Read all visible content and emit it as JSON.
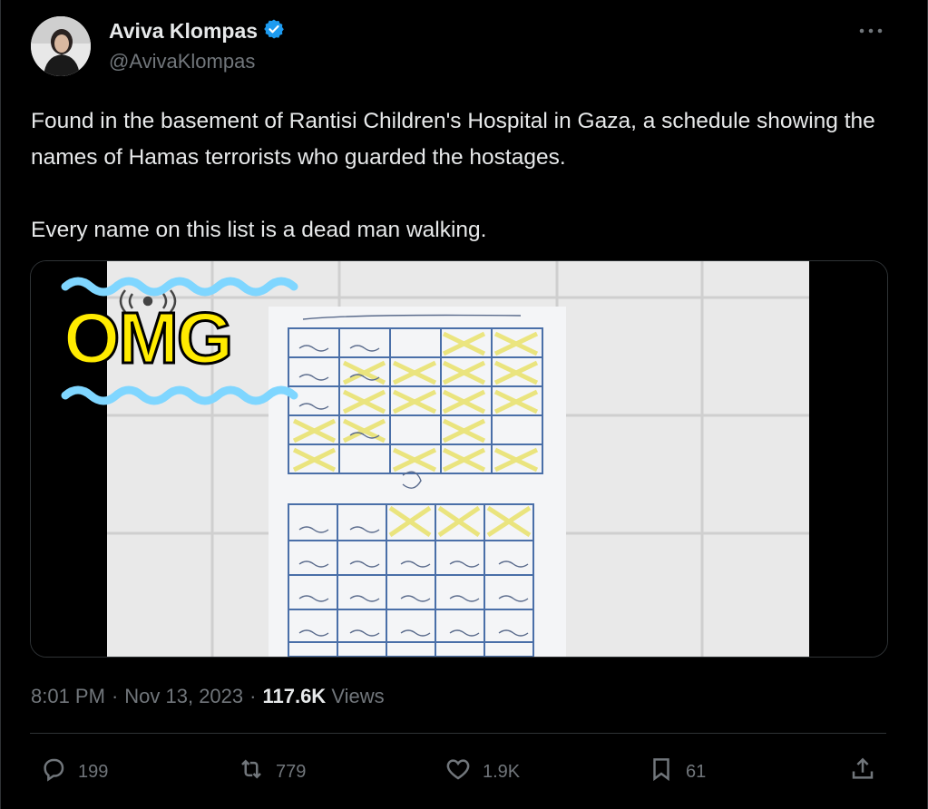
{
  "author": {
    "name": "Aviva Klompas",
    "handle": "@AvivaKlompas",
    "verified": true,
    "verified_color": "#1d9bf0"
  },
  "tweet": {
    "text": "Found in the basement of Rantisi Children's Hospital in Gaza, a schedule showing the names of Hamas terrorists who guarded the hostages.\n\nEvery name on this list is a dead man walking.",
    "image_overlay_text": "OMG"
  },
  "meta": {
    "time": "8:01 PM",
    "separator": "·",
    "date": "Nov 13, 2023",
    "views_count": "117.6K",
    "views_label": "Views"
  },
  "actions": {
    "replies": "199",
    "reposts": "779",
    "likes": "1.9K",
    "bookmarks": "61"
  },
  "colors": {
    "background": "#000000",
    "text": "#e7e9ea",
    "secondary": "#71767b",
    "border": "#2f3336",
    "omg_yellow": "#ffeb00",
    "omg_wave": "#7fd6ff"
  }
}
